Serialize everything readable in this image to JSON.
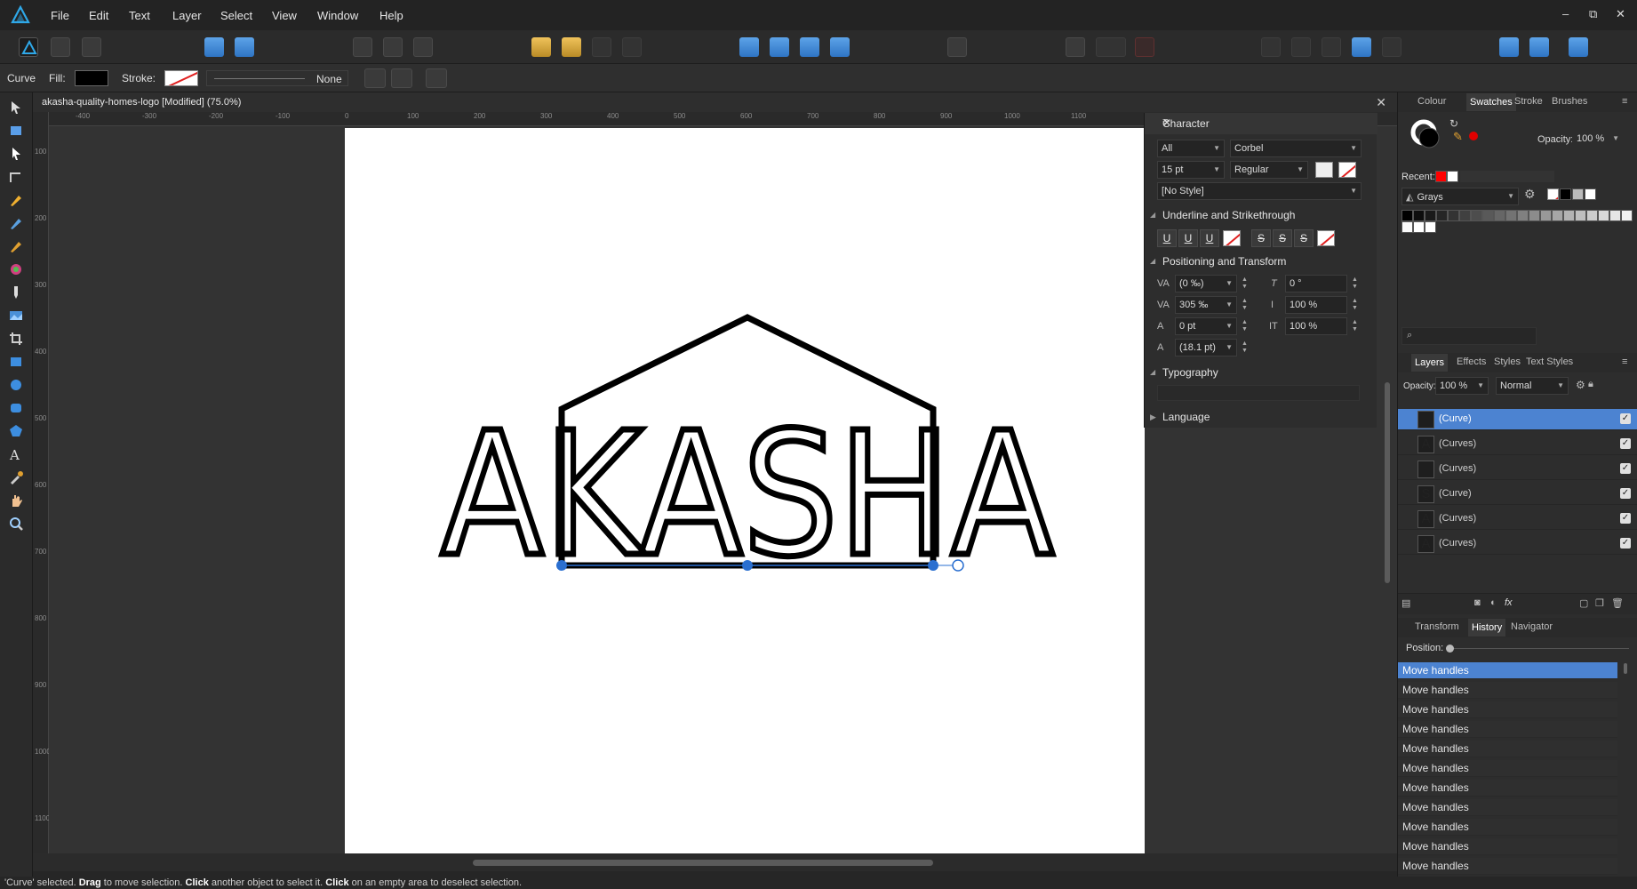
{
  "menu": {
    "items": [
      "File",
      "Edit",
      "Text",
      "Layer",
      "Select",
      "View",
      "Window",
      "Help"
    ]
  },
  "window_controls": {
    "minimize": "–",
    "restore": "⧉",
    "close": "✕"
  },
  "context": {
    "tool_label": "Curve",
    "fill_label": "Fill:",
    "stroke_label": "Stroke:",
    "stroke_style": "None",
    "fill_color": "#000000"
  },
  "document": {
    "title": "akasha-quality-homes-logo [Modified] (75.0%)",
    "close": "✕",
    "logo_text": "AKASHA"
  },
  "rulers": {
    "horizontal": [
      "-400",
      "-300",
      "-200",
      "-100",
      "0",
      "100",
      "200",
      "300",
      "400",
      "500",
      "600",
      "700",
      "800",
      "900",
      "1000",
      "1100"
    ],
    "vertical": [
      "100",
      "200",
      "300",
      "400",
      "500",
      "600",
      "700",
      "800",
      "900",
      "1000",
      "1100"
    ]
  },
  "character": {
    "title": "Character",
    "scope": "All",
    "font": "Corbel",
    "size": "15 pt",
    "weight": "Regular",
    "style": "[No Style]",
    "section_underline": "Underline and Strikethrough",
    "underline_buttons": [
      "U",
      "U",
      "U"
    ],
    "strike_buttons": [
      "S",
      "S",
      "S"
    ],
    "section_position": "Positioning and Transform",
    "kerning": "(0 ‰)",
    "tracking": "305 ‰",
    "baseline": "0 pt",
    "leading": "(18.1 pt)",
    "shear": "0 °",
    "vscale": "100 %",
    "hscale": "100 %",
    "section_typography": "Typography",
    "section_language": "Language"
  },
  "swatches_panel": {
    "tabs": [
      "Colour",
      "Swatches",
      "Stroke",
      "Brushes"
    ],
    "active_tab": "Swatches",
    "opacity_label": "Opacity:",
    "opacity_value": "100 %",
    "recent_label": "Recent:",
    "palette": "Grays",
    "recent_colors": [
      "#ff0000",
      "#ffffff"
    ],
    "grays": [
      "#000000",
      "#0d0d0d",
      "#1a1a1a",
      "#262626",
      "#333333",
      "#404040",
      "#4d4d4d",
      "#595959",
      "#666666",
      "#737373",
      "#808080",
      "#8c8c8c",
      "#999999",
      "#a6a6a6",
      "#b3b3b3",
      "#bfbfbf",
      "#cccccc",
      "#d9d9d9",
      "#e6e6e6",
      "#f2f2f2",
      "#fafafa",
      "#ffffff",
      "#ffffff"
    ]
  },
  "layers_panel": {
    "tabs": [
      "Layers",
      "Effects",
      "Styles",
      "Text Styles"
    ],
    "active_tab": "Layers",
    "opacity_label": "Opacity:",
    "opacity_value": "100 %",
    "blend_mode": "Normal",
    "fx_label": "fx",
    "rows": [
      {
        "name": "(Curve)",
        "thumb": "",
        "selected": true
      },
      {
        "name": "(Curves)",
        "thumb": "A",
        "selected": false
      },
      {
        "name": "(Curves)",
        "thumb": "",
        "selected": false
      },
      {
        "name": "(Curve)",
        "thumb": "S",
        "selected": false
      },
      {
        "name": "(Curves)",
        "thumb": "A",
        "selected": false
      },
      {
        "name": "(Curves)",
        "thumb": "A",
        "selected": false
      }
    ]
  },
  "history_panel": {
    "tabs": [
      "Transform",
      "History",
      "Navigator"
    ],
    "active_tab": "History",
    "position_label": "Position:",
    "entries": [
      "Move handles",
      "Move handles",
      "Move handles",
      "Move handles",
      "Move handles",
      "Move handles",
      "Move handles",
      "Move handles",
      "Move handles",
      "Move handles",
      "Move handles"
    ]
  },
  "status": {
    "p1": "'Curve' selected. ",
    "b1": "Drag",
    "p2": " to move selection. ",
    "b2": "Click",
    "p3": " another object to select it. ",
    "b3": "Click",
    "p4": " on an empty area to deselect selection."
  },
  "colors": {
    "accent": "#4c83d1",
    "app_logo": "#2fa8e8",
    "warning_red": "#e02020"
  }
}
